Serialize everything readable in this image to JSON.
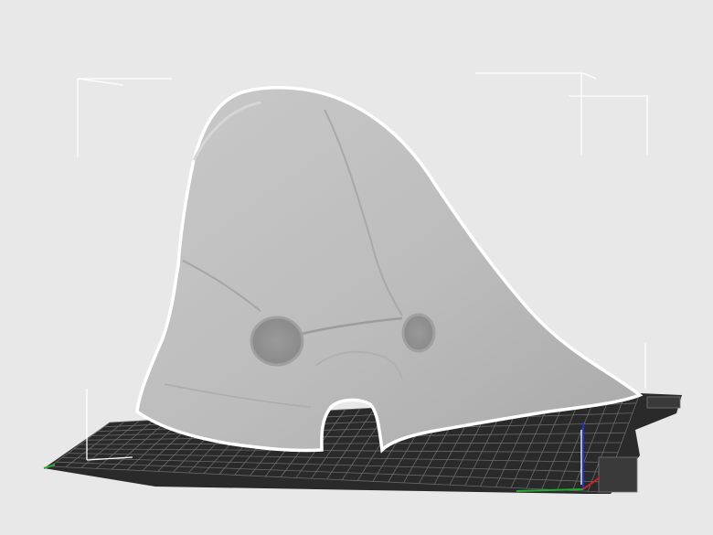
{
  "viewport": {
    "background_color": "#e8e8e8",
    "bed_color": "#2a2a2a",
    "bed_grid_color": "#6a6a6a",
    "model_color": "#bdbdbd",
    "outline_color": "#ffffff",
    "bounding_box_color": "#ffffff",
    "axis_colors": {
      "x": "#cc2222",
      "y": "#22aa33",
      "z": "#2233cc"
    }
  },
  "model": {
    "icon": "mask-model-icon",
    "selected": true
  }
}
